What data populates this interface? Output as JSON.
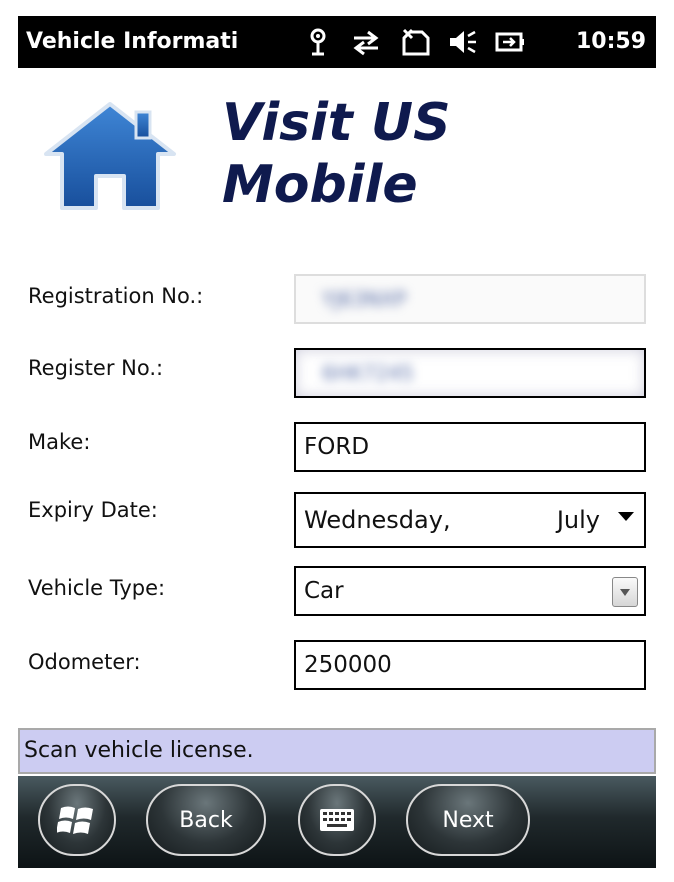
{
  "titlebar": {
    "title": "Vehicle Informati",
    "clock": "10:59",
    "icons": [
      "signal-antenna-icon",
      "data-sync-icon",
      "no-sim-icon",
      "speaker-muted-icon",
      "battery-charging-icon"
    ]
  },
  "header": {
    "brand_line1": "Visit US",
    "brand_line2": "Mobile",
    "logo_icon": "house-logo-icon",
    "logo_color": "#1f5fb0",
    "brand_color": "#0f1a4e"
  },
  "form": {
    "registration_no": {
      "label": "Registration No.:",
      "value": "YJ63NXP"
    },
    "register_no": {
      "label": "Register No.:",
      "value": "6HK7245"
    },
    "make": {
      "label": "Make:",
      "value": "FORD"
    },
    "expiry_date": {
      "label": "Expiry Date:",
      "day": "Wednesday,",
      "month": "July"
    },
    "vehicle_type": {
      "label": "Vehicle Type:",
      "value": "Car"
    },
    "odometer": {
      "label": "Odometer:",
      "value": "250000"
    }
  },
  "status": {
    "message": "Scan vehicle license.",
    "background": "#ccccf2"
  },
  "softkeys": {
    "back_label": "Back",
    "next_label": "Next",
    "start_icon": "windows-start-icon",
    "keyboard_icon": "keyboard-icon"
  }
}
